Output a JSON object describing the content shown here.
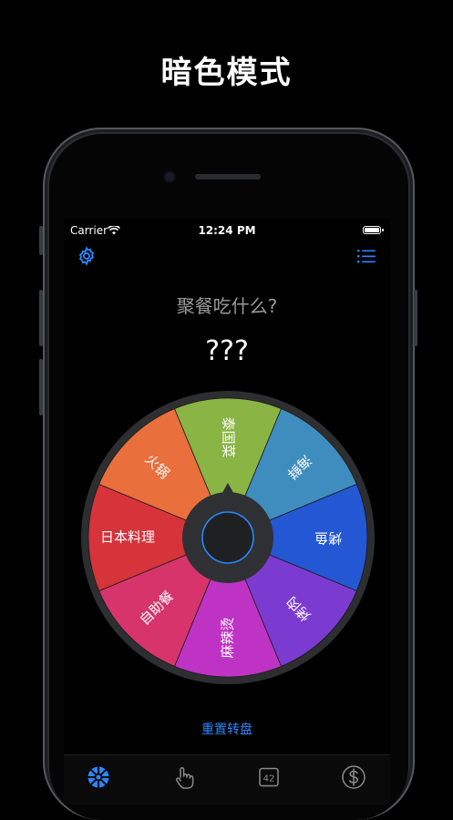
{
  "headline": "暗色模式",
  "status": {
    "carrier": "Carrier",
    "time": "12:24 PM"
  },
  "header": {
    "settings_icon": "gear-icon",
    "list_icon": "list-icon"
  },
  "question": "聚餐吃什么?",
  "result": "???",
  "wheel": {
    "segments": [
      {
        "label": "泰国菜",
        "color": "#8ab443"
      },
      {
        "label": "海鲜",
        "color": "#3f8dbf"
      },
      {
        "label": "烤鱼",
        "color": "#2457d3"
      },
      {
        "label": "烤肉",
        "color": "#7b3bd1"
      },
      {
        "label": "麻辣烫",
        "color": "#be33c4"
      },
      {
        "label": "自助餐",
        "color": "#d7346c"
      },
      {
        "label": "日本料理",
        "color": "#d6333b"
      },
      {
        "label": "火锅",
        "color": "#e96f3d"
      }
    ]
  },
  "reset_label": "重置转盘",
  "tabs": [
    {
      "icon": "wheel-icon",
      "active": true
    },
    {
      "icon": "hand-tap-icon",
      "active": false
    },
    {
      "icon": "number-icon",
      "text": "42",
      "active": false
    },
    {
      "icon": "dollar-icon",
      "active": false
    }
  ],
  "colors": {
    "accent": "#2b86ff",
    "rim": "#2d2e30",
    "hub": "#2f3033"
  }
}
